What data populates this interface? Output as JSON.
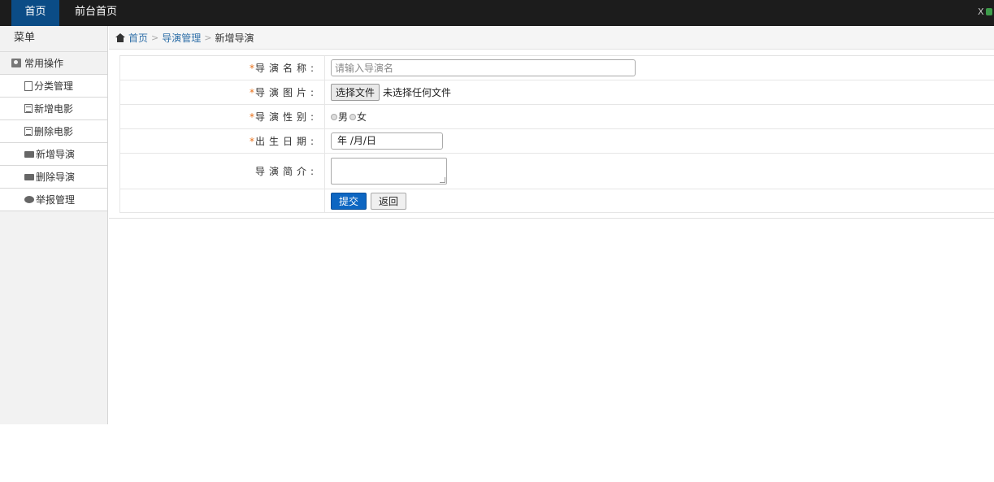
{
  "navbar": {
    "tabs": [
      {
        "label": "首页"
      },
      {
        "label": "前台首页"
      }
    ],
    "corner_text": "X"
  },
  "sidebar": {
    "title": "菜单",
    "group": {
      "label": "常用操作",
      "icon": "user-card-icon"
    },
    "items": [
      {
        "label": "分类管理",
        "icon": "file-icon"
      },
      {
        "label": "新增电影",
        "icon": "list-icon"
      },
      {
        "label": "删除电影",
        "icon": "list-icon"
      },
      {
        "label": "新增导演",
        "icon": "film-icon"
      },
      {
        "label": "删除导演",
        "icon": "film-icon"
      },
      {
        "label": "举报管理",
        "icon": "chat-icon"
      }
    ]
  },
  "breadcrumb": {
    "home": "首页",
    "section": "导演管理",
    "current": "新增导演",
    "separator": ">"
  },
  "form": {
    "required_mark": "*",
    "colon": ":",
    "name": {
      "label": "导演名称",
      "placeholder": "请输入导演名",
      "value": ""
    },
    "photo": {
      "label": "导演图片",
      "button": "选择文件",
      "status": "未选择任何文件"
    },
    "gender": {
      "label": "导演性别",
      "options": [
        "男",
        "女"
      ]
    },
    "birth": {
      "label": "出生日期",
      "value": "年 /月/日"
    },
    "intro": {
      "label": "导演简介",
      "value": ""
    },
    "submit": "提交",
    "back": "返回"
  },
  "colors": {
    "navbar_bg": "#1c1c1c",
    "active_tab": "#0b4c86",
    "link": "#2f6fa8",
    "required": "#e8711b",
    "submit_bg": "#0d66c2"
  }
}
